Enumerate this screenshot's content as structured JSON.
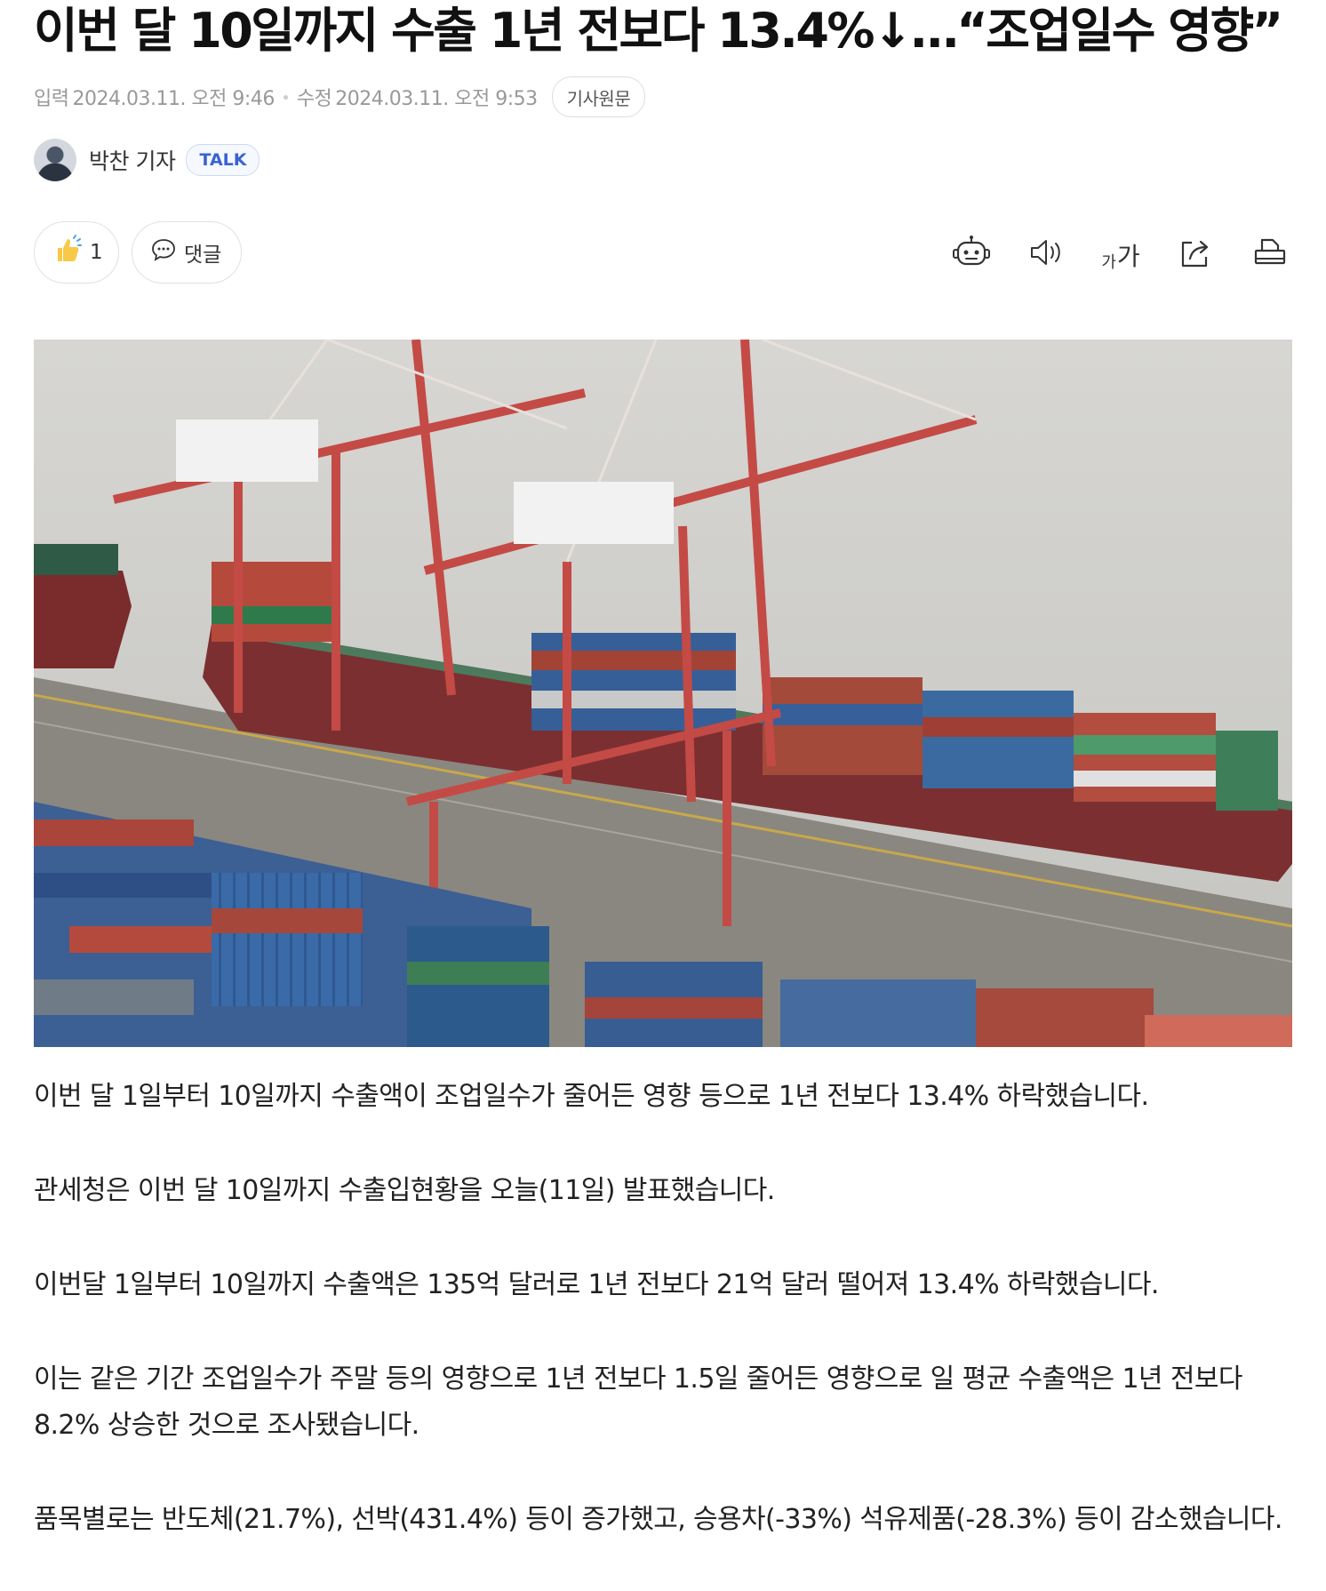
{
  "article": {
    "headline": "이번 달 10일까지 수출 1년 전보다 13.4%↓…“조업일수 영향”",
    "meta": {
      "input_label": "입력",
      "input_time": "2024.03.11. 오전 9:46",
      "edit_label": "수정",
      "edit_time": "2024.03.11. 오전 9:53",
      "origin_button": "기사원문"
    },
    "reporter": {
      "name": "박찬 기자",
      "talk_label": "TALK"
    },
    "actions": {
      "like_count": "1",
      "comment_label": "댓글",
      "font_size_small": "가",
      "font_size_large": "가"
    },
    "paragraphs": [
      "이번 달 1일부터 10일까지 수출액이 조업일수가 줄어든 영향 등으로 1년 전보다 13.4% 하락했습니다.",
      "관세청은 이번 달 10일까지 수출입현황을 오늘(11일) 발표했습니다.",
      "이번달 1일부터 10일까지 수출액은 135억 달러로 1년 전보다 21억 달러 떨어져 13.4% 하락했습니다.",
      "이는 같은 기간 조업일수가 주말 등의 영향으로 1년 전보다 1.5일 줄어든 영향으로 일 평균 수출액은 1년 전보다 8.2% 상승한 것으로 조사됐습니다.",
      "품목별로는 반도체(21.7%), 선박(431.4%) 등이 증가했고, 승용차(-33%) 석유제품(-28.3%) 등이 감소했습니다."
    ]
  },
  "icons": {
    "like": "thumbs-up-icon",
    "comment": "speech-bubble-icon",
    "robot": "robot-icon",
    "speaker": "speaker-icon",
    "share": "share-icon",
    "print": "print-icon"
  },
  "colors": {
    "talk_accent": "#3b62d4",
    "crane_red": "#c44a46",
    "sea": "#cfd0cc"
  }
}
